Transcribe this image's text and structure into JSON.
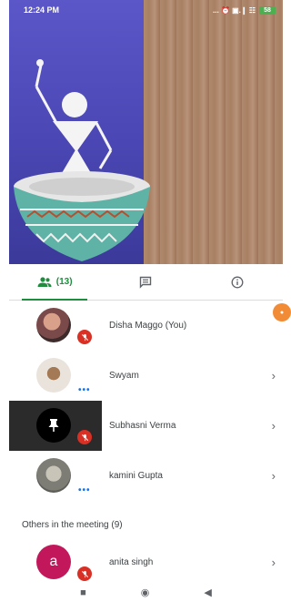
{
  "status_bar": {
    "time": "12:24 PM",
    "indicators": "... ⏰ ▣.❙ ☷",
    "battery": "58"
  },
  "tabs": {
    "people_count": "(13)"
  },
  "participants": [
    {
      "name": "Disha Maggo (You)",
      "muted": true,
      "avatar_color": "#8b5e5e",
      "orange_badge": true
    },
    {
      "name": "Swyam",
      "muted": false,
      "speaking_dots": "•••",
      "avatar_color": "#d9cfc6"
    },
    {
      "name": "Subhasni Verma",
      "muted": true,
      "avatar_icon": "pin-icon",
      "avatar_color": "#000000"
    },
    {
      "name": "kamini Gupta",
      "muted": false,
      "speaking_dots": "•••",
      "avatar_color": "#9a9a92"
    }
  ],
  "others_section": {
    "title": "Others in the meeting (9)"
  },
  "others": [
    {
      "name": "anita singh",
      "initial": "a",
      "muted": true,
      "avatar_color": "#c2185b"
    }
  ],
  "navbar": {
    "square": "■",
    "circle": "◉",
    "back": "◀"
  },
  "colors": {
    "accent_green": "#1e8e3e",
    "mute_red": "#d93025",
    "dots_blue": "#1a73e8"
  }
}
